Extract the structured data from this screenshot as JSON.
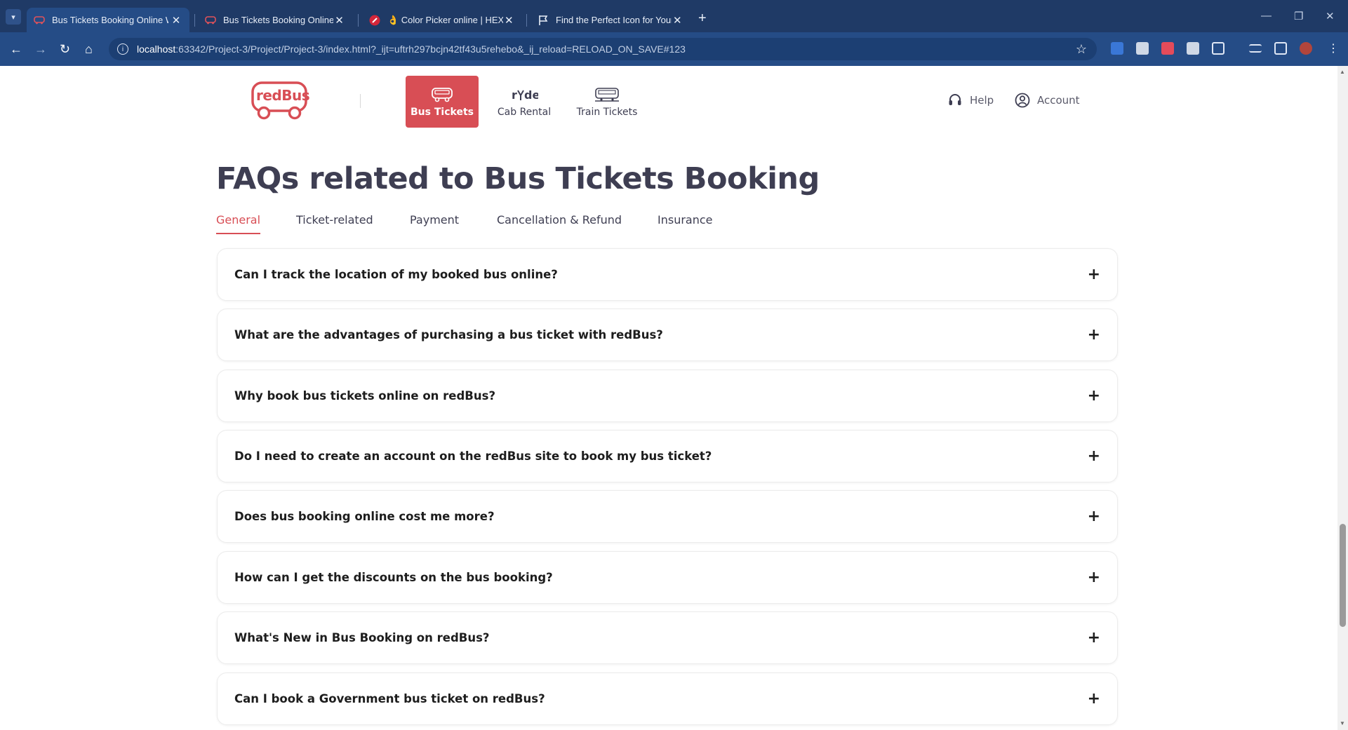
{
  "browser": {
    "tabs": [
      {
        "title": "Bus Tickets Booking Online Wit",
        "active": true
      },
      {
        "title": "Bus Tickets Booking Online wit",
        "active": false
      },
      {
        "title": "👌 Color Picker online | HEX Co",
        "active": false
      },
      {
        "title": "Find the Perfect Icon for Your P",
        "active": false
      }
    ],
    "new_tab_glyph": "+",
    "url_host": "localhost",
    "url_rest": ":63342/Project-3/Project/Project-3/index.html?_ijt=uftrh297bcjn42tf43u5rehebo&_ij_reload=RELOAD_ON_SAVE#123"
  },
  "header": {
    "logo_text": "redBus",
    "nav": [
      {
        "label": "Bus Tickets",
        "icon": "bus-icon",
        "active": true
      },
      {
        "label": "Cab Rental",
        "icon": "ryde-icon",
        "active": false
      },
      {
        "label": "Train Tickets",
        "icon": "train-icon",
        "active": false
      }
    ],
    "help_label": "Help",
    "account_label": "Account"
  },
  "faq": {
    "title": "FAQs related to Bus Tickets Booking",
    "tabs": [
      "General",
      "Ticket-related",
      "Payment",
      "Cancellation & Refund",
      "Insurance"
    ],
    "active_tab": "General",
    "questions": [
      "Can I track the location of my booked bus online?",
      "What are the advantages of purchasing a bus ticket with redBus?",
      "Why book bus tickets online on redBus?",
      "Do I need to create an account on the redBus site to book my bus ticket?",
      "Does bus booking online cost me more?",
      "How can I get the discounts on the bus booking?",
      "What's New in Bus Booking on redBus?",
      "Can I book a Government bus ticket on redBus?"
    ],
    "expand_glyph": "+"
  },
  "colors": {
    "brand_red": "#d84e55",
    "tabstrip": "#1f3a66",
    "toolbar": "#254c86",
    "text_dark": "#3e3e52"
  }
}
